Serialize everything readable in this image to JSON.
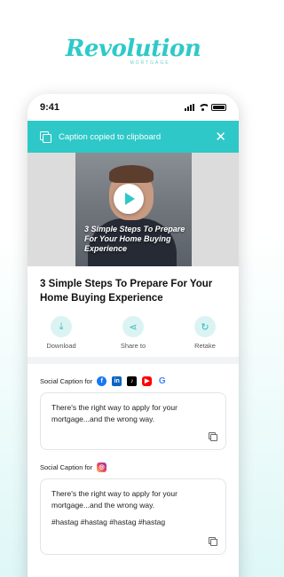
{
  "brand": {
    "name": "Revolution",
    "sub": "MORTGAGE"
  },
  "status": {
    "time": "9:41"
  },
  "toast": {
    "message": "Caption copied to clipboard",
    "close": "✕"
  },
  "video": {
    "overlay_text": "3 Simple Steps To Prepare For Your Home Buying Experience"
  },
  "post": {
    "title": "3 Simple Steps To Prepare For Your Home Buying Experience"
  },
  "actions": [
    {
      "label": "Download",
      "icon": "download-icon",
      "glyph": "⤓"
    },
    {
      "label": "Share to",
      "icon": "share-icon",
      "glyph": "⋖"
    },
    {
      "label": "Retake",
      "icon": "retake-icon",
      "glyph": "↻"
    }
  ],
  "social1": {
    "label": "Social Caption for",
    "platforms": [
      "facebook",
      "linkedin",
      "tiktok",
      "youtube-shorts",
      "google"
    ],
    "caption": "There's the right way to apply for your mortgage...and the wrong way."
  },
  "social2": {
    "label": "Social Caption for",
    "platforms": [
      "instagram"
    ],
    "caption": "There's the right way to apply for your mortgage...and the wrong way.",
    "hashtags": "#hastag #hastag #hastag #hastag"
  },
  "colors": {
    "accent": "#2fc8c8",
    "brand": "#2ec9c9"
  }
}
